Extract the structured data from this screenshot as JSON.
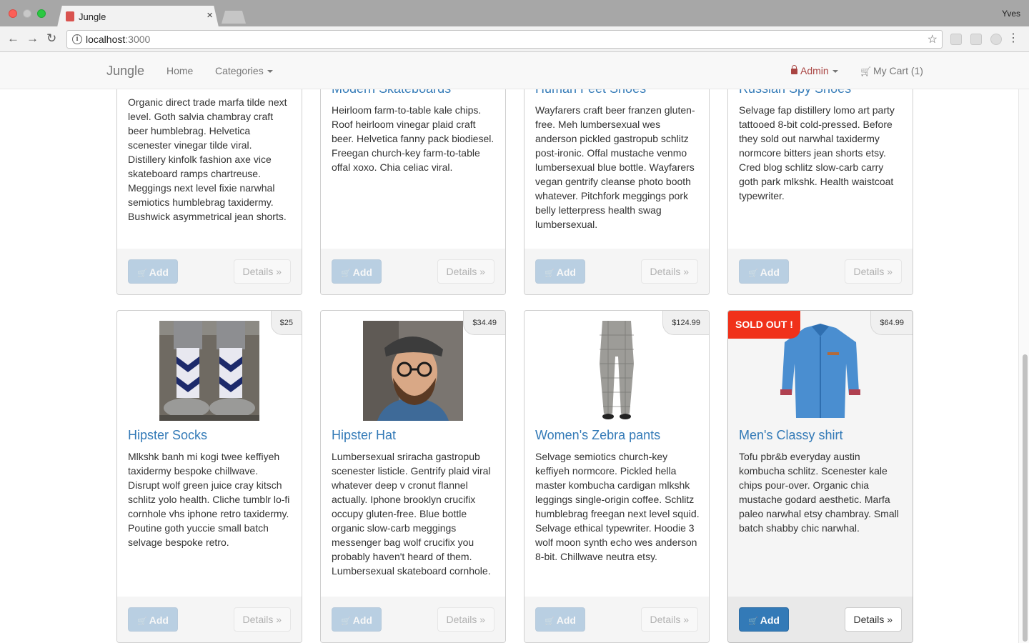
{
  "browser": {
    "tab_title": "Jungle",
    "tab_close": "×",
    "profile_name": "Yves",
    "url_host": "localhost",
    "url_port": ":3000",
    "info_glyph": "i",
    "back_glyph": "←",
    "forward_glyph": "→",
    "reload_glyph": "↻",
    "star_glyph": "☆",
    "menu_glyph": "⋮"
  },
  "nav": {
    "brand": "Jungle",
    "home": "Home",
    "categories": "Categories",
    "admin": "Admin",
    "cart": "My Cart (1)",
    "cart_glyph": "🛒"
  },
  "buttons": {
    "add": "Add",
    "details": "Details »",
    "cart_glyph": "🛒"
  },
  "products_top": [
    {
      "name": "",
      "description": "Organic direct trade marfa tilde next level. Goth salvia chambray craft beer humblebrag. Helvetica scenester vinegar tilde viral. Distillery kinfolk fashion axe vice skateboard ramps chartreuse. Meggings next level fixie narwhal semiotics humblebrag taxidermy. Bushwick asymmetrical jean shorts."
    },
    {
      "name": "Modern Skateboards",
      "description": "Heirloom farm-to-table kale chips. Roof heirloom vinegar plaid craft beer. Helvetica fanny pack biodiesel. Freegan church-key farm-to-table offal xoxo. Chia celiac viral."
    },
    {
      "name": "Human Feet Shoes",
      "description": "Wayfarers craft beer franzen gluten-free. Meh lumbersexual wes anderson pickled gastropub schlitz post-ironic. Offal mustache venmo lumbersexual blue bottle. Wayfarers vegan gentrify cleanse photo booth whatever. Pitchfork meggings pork belly letterpress health swag lumbersexual."
    },
    {
      "name": "Russian Spy Shoes",
      "description": "Selvage fap distillery lomo art party tattooed 8-bit cold-pressed. Before they sold out narwhal taxidermy normcore bitters jean shorts etsy. Cred blog schlitz slow-carb carry goth park mlkshk. Health waistcoat typewriter."
    }
  ],
  "products_bottom": [
    {
      "name": "Hipster Socks",
      "price": "$25",
      "image": "socks",
      "description": "Mlkshk banh mi kogi twee keffiyeh taxidermy bespoke chillwave. Disrupt wolf green juice cray kitsch schlitz yolo health. Cliche tumblr lo-fi cornhole vhs iphone retro taxidermy. Poutine goth yuccie small batch selvage bespoke retro."
    },
    {
      "name": "Hipster Hat",
      "price": "$34.49",
      "image": "hat",
      "description": "Lumbersexual sriracha gastropub scenester listicle. Gentrify plaid viral whatever deep v cronut flannel actually. Iphone brooklyn crucifix occupy gluten-free. Blue bottle organic slow-carb meggings messenger bag wolf crucifix you probably haven't heard of them. Lumbersexual skateboard cornhole."
    },
    {
      "name": "Women's Zebra pants",
      "price": "$124.99",
      "image": "pants",
      "description": "Selvage semiotics church-key keffiyeh normcore. Pickled hella master kombucha cardigan mlkshk leggings single-origin coffee. Schlitz humblebrag freegan next level squid. Selvage ethical typewriter. Hoodie 3 wolf moon synth echo wes anderson 8-bit. Chillwave neutra etsy."
    },
    {
      "name": "Men's Classy shirt",
      "price": "$64.99",
      "image": "shirt",
      "sold_out": "SOLD OUT !",
      "description": "Tofu pbr&b everyday austin kombucha schlitz. Scenester kale chips pour-over. Organic chia mustache godard aesthetic. Marfa paleo narwhal etsy chambray. Small batch shabby chic narwhal."
    }
  ]
}
